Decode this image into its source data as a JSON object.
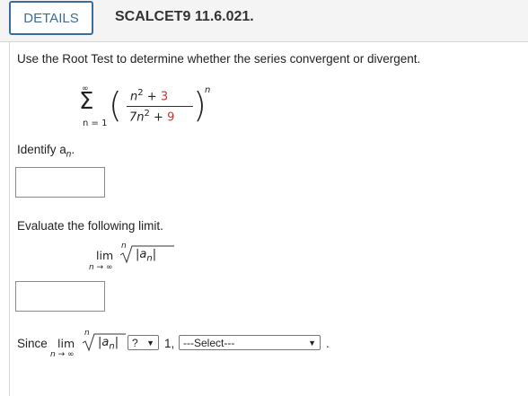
{
  "header": {
    "details_label": "DETAILS",
    "problem_id": "SCALCET9 11.6.021."
  },
  "problem": {
    "instruction": "Use the Root Test to determine whether the series convergent or divergent.",
    "series": {
      "sigma": "Σ",
      "upper": "∞",
      "lower": "n = 1",
      "numerator_base": "n",
      "numerator_exp": "2",
      "numerator_plus": "+",
      "numerator_const": "3",
      "denominator_base": "7n",
      "denominator_exp": "2",
      "denominator_plus": "+",
      "denominator_const": "9",
      "outer_exp": "n",
      "paren_left": "(",
      "paren_right": ")"
    },
    "identify_label": "Identify a",
    "identify_sub": "n",
    "identify_period": ".",
    "identify_value": "",
    "evaluate_label": "Evaluate the following limit.",
    "limit": {
      "lim": "lim",
      "under": "n → ∞",
      "root_index": "n",
      "radicand": "|a",
      "radicand_sub": "n",
      "radicand_close": "|"
    },
    "limit_value": "",
    "since": {
      "since_label": "Since",
      "lim": "lim",
      "under": "n → ∞",
      "root_index": "n",
      "radicand": "|a",
      "radicand_sub": "n",
      "radicand_close": "|",
      "compare_select": "?",
      "one_comma": "1,",
      "conclusion_select": "---Select---",
      "final_period": "."
    }
  }
}
